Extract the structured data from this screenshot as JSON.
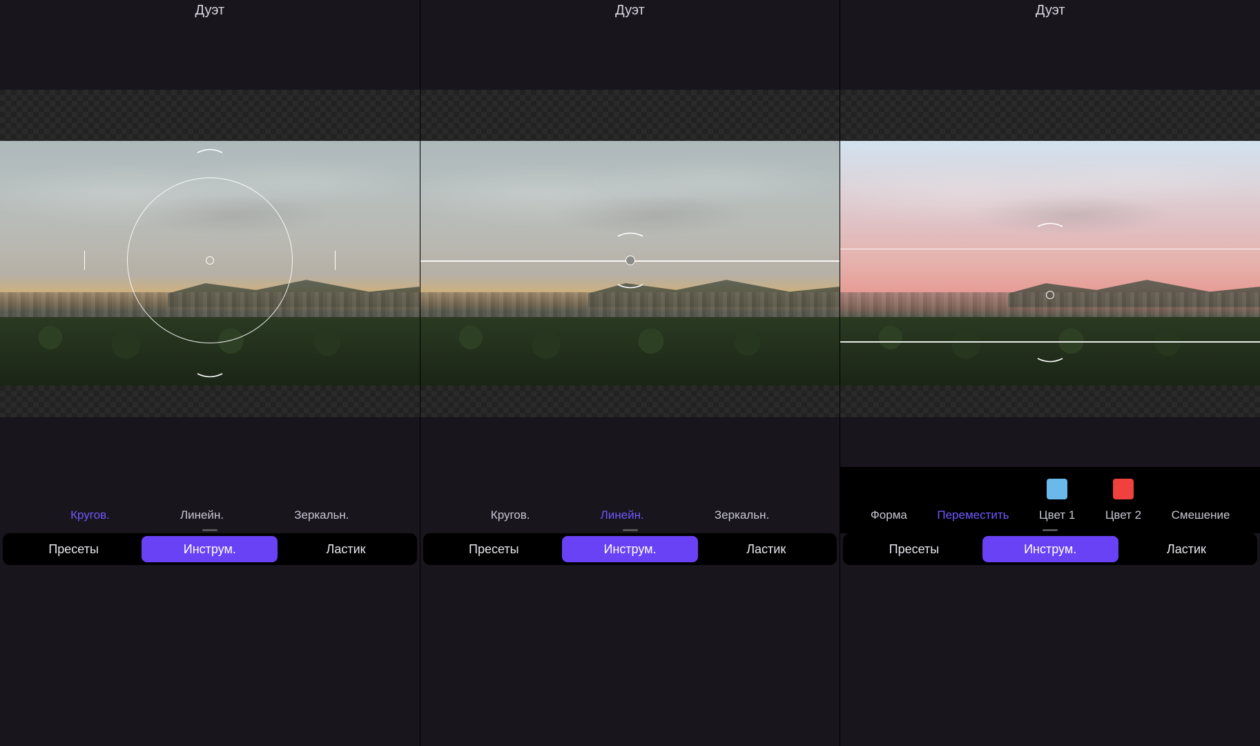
{
  "screens": [
    {
      "title": "Дуэт",
      "options_variant": "shape",
      "shape_options": [
        {
          "key": "circular",
          "label": "Кругов.",
          "selected": true
        },
        {
          "key": "linear",
          "label": "Линейн.",
          "selected": false
        },
        {
          "key": "mirror",
          "label": "Зеркальн.",
          "selected": false
        }
      ],
      "tabs": [
        {
          "label": "Пресеты",
          "selected": false
        },
        {
          "label": "Инструм.",
          "selected": true
        },
        {
          "label": "Ластик",
          "selected": false
        }
      ],
      "overlay": "circle"
    },
    {
      "title": "Дуэт",
      "options_variant": "shape",
      "shape_options": [
        {
          "key": "circular",
          "label": "Кругов.",
          "selected": false
        },
        {
          "key": "linear",
          "label": "Линейн.",
          "selected": true
        },
        {
          "key": "mirror",
          "label": "Зеркальн.",
          "selected": false
        }
      ],
      "tabs": [
        {
          "label": "Пресеты",
          "selected": false
        },
        {
          "label": "Инструм.",
          "selected": true
        },
        {
          "label": "Ластик",
          "selected": false
        }
      ],
      "overlay": "line"
    },
    {
      "title": "Дуэт",
      "options_variant": "color",
      "color_options": [
        {
          "key": "shape",
          "label": "Форма"
        },
        {
          "key": "move",
          "label": "Переместить",
          "selected": true
        },
        {
          "key": "c1",
          "label": "Цвет 1",
          "swatch": "#6bb9eb"
        },
        {
          "key": "c2",
          "label": "Цвет 2",
          "swatch": "#f0413f"
        },
        {
          "key": "blend",
          "label": "Смешение"
        }
      ],
      "tabs": [
        {
          "label": "Пресеты",
          "selected": false
        },
        {
          "label": "Инструм.",
          "selected": true
        },
        {
          "label": "Ластик",
          "selected": false
        }
      ],
      "overlay": "lines2"
    }
  ],
  "icons": {
    "undo": "undo",
    "redo": "redo",
    "compare": "compare",
    "close": "close",
    "confirm": "confirm"
  }
}
